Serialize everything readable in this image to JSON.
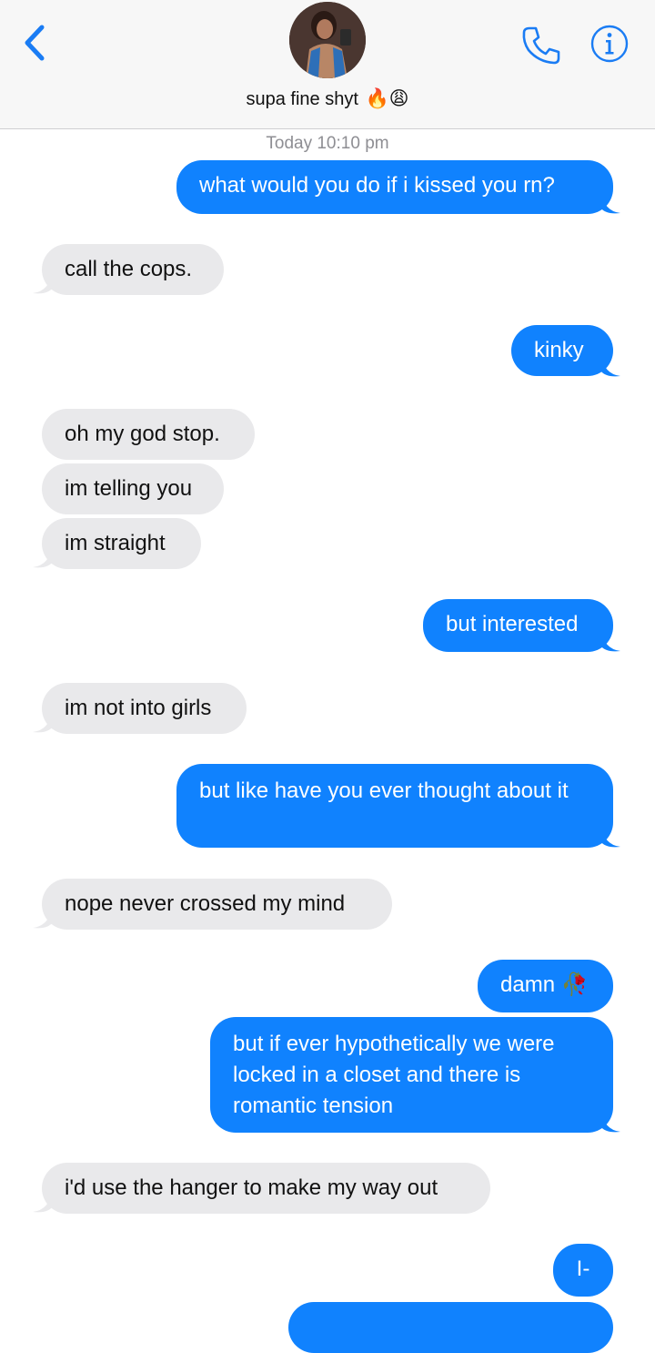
{
  "header": {
    "contact_name": "supa fine shyt",
    "contact_emoji": "🔥😩"
  },
  "thread": {
    "timestamp": "Today 10:10 pm",
    "messages": [
      {
        "from": "me",
        "text": "what would you do if i kissed you rn?"
      },
      {
        "from": "them",
        "text": "call the cops."
      },
      {
        "from": "me",
        "text": "kinky"
      },
      {
        "from": "them",
        "text": "oh my god stop."
      },
      {
        "from": "them",
        "text": "im telling you"
      },
      {
        "from": "them",
        "text": "im straight"
      },
      {
        "from": "me",
        "text": "but interested"
      },
      {
        "from": "them",
        "text": "im not into girls"
      },
      {
        "from": "me",
        "text": "but like have you ever thought about it"
      },
      {
        "from": "them",
        "text": "nope never crossed my mind"
      },
      {
        "from": "me",
        "text": "damn 🥀"
      },
      {
        "from": "me",
        "text": "but if ever hypothetically we were locked in a closet and there is romantic tension"
      },
      {
        "from": "them",
        "text": "i'd use the hanger to make my way out"
      },
      {
        "from": "me",
        "text": "I-"
      }
    ]
  },
  "colors": {
    "sent_bubble": "#1082fe",
    "received_bubble": "#e9e9eb",
    "accent": "#1a7cf4"
  },
  "icons": [
    "back-chevron-icon",
    "phone-icon",
    "info-icon"
  ]
}
